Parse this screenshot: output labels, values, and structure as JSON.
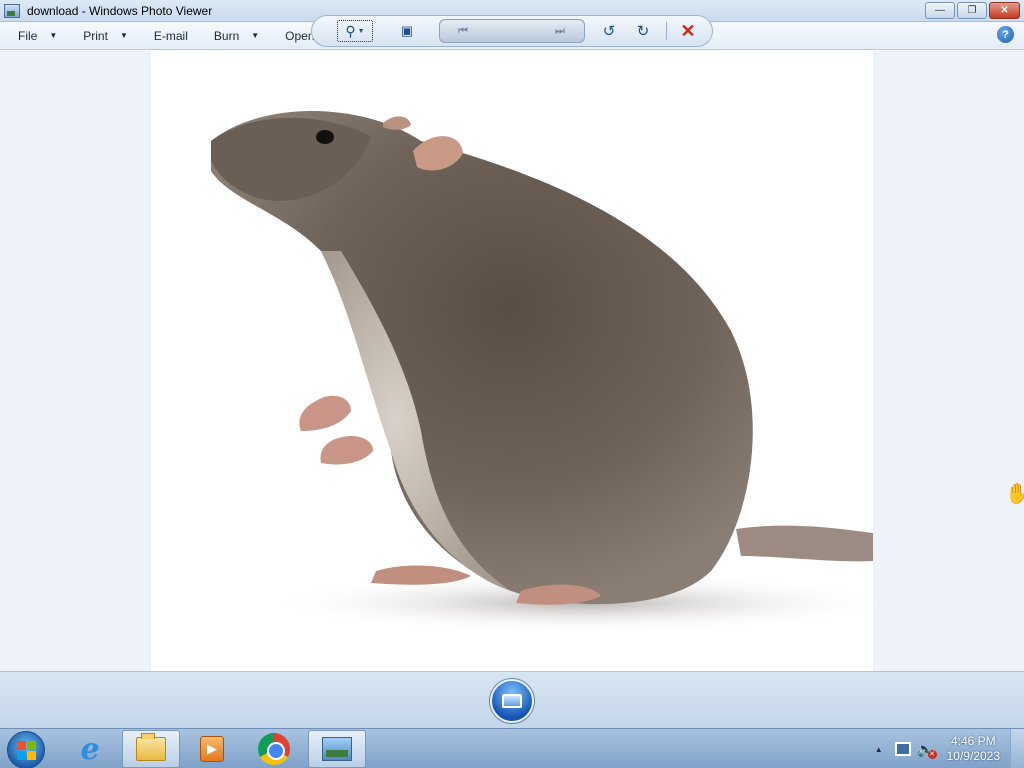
{
  "window": {
    "title": "download - Windows Photo Viewer",
    "icons": {
      "app": "photo-viewer-icon",
      "minimize": "minimize-icon",
      "maximize": "restore-icon",
      "close": "close-icon"
    }
  },
  "menu": {
    "items": [
      {
        "label": "File",
        "has_dropdown": true
      },
      {
        "label": "Print",
        "has_dropdown": true
      },
      {
        "label": "E-mail",
        "has_dropdown": false
      },
      {
        "label": "Burn",
        "has_dropdown": true
      },
      {
        "label": "Open",
        "has_dropdown": true
      }
    ],
    "help_label": "?"
  },
  "controls": {
    "zoom": "zoom-icon",
    "actual_size": "actual-size-icon",
    "previous": "previous-icon",
    "slideshow": "slideshow-icon",
    "next": "next-icon",
    "rotate_left": "rotate-counterclockwise-icon",
    "rotate_right": "rotate-clockwise-icon",
    "delete": "delete-icon"
  },
  "taskbar": {
    "items": [
      "start-orb",
      "internet-explorer-icon",
      "windows-explorer-icon",
      "media-player-icon",
      "chrome-icon",
      "photo-viewer-icon"
    ],
    "active_item": "windows-explorer-icon",
    "clock": {
      "time": "4:46 PM",
      "date": "10/9/2023"
    }
  },
  "colors": {
    "window_accent": "#c9dbef",
    "close_button": "#c23a22",
    "delete_icon": "#d0241c",
    "taskbar": "#7fa2c9"
  }
}
